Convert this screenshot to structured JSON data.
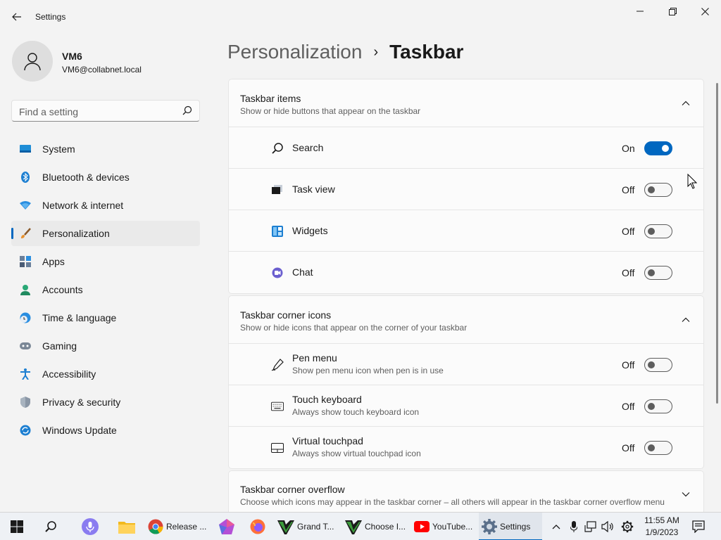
{
  "window": {
    "title": "Settings"
  },
  "profile": {
    "name": "VM6",
    "email": "VM6@collabnet.local"
  },
  "search": {
    "placeholder": "Find a setting"
  },
  "nav": {
    "items": [
      {
        "label": "System",
        "icon": "system-icon"
      },
      {
        "label": "Bluetooth & devices",
        "icon": "bluetooth-icon"
      },
      {
        "label": "Network & internet",
        "icon": "network-icon"
      },
      {
        "label": "Personalization",
        "icon": "brush-icon",
        "selected": true
      },
      {
        "label": "Apps",
        "icon": "apps-icon"
      },
      {
        "label": "Accounts",
        "icon": "accounts-icon"
      },
      {
        "label": "Time & language",
        "icon": "clock-globe-icon"
      },
      {
        "label": "Gaming",
        "icon": "controller-icon"
      },
      {
        "label": "Accessibility",
        "icon": "accessibility-icon"
      },
      {
        "label": "Privacy & security",
        "icon": "shield-icon"
      },
      {
        "label": "Windows Update",
        "icon": "update-icon"
      }
    ]
  },
  "header": {
    "parent": "Personalization",
    "separator": "›",
    "current": "Taskbar"
  },
  "sections": {
    "taskbar_items": {
      "title": "Taskbar items",
      "description": "Show or hide buttons that appear on the taskbar",
      "rows": [
        {
          "label": "Search",
          "state": "On",
          "on": true,
          "icon": "search-icon"
        },
        {
          "label": "Task view",
          "state": "Off",
          "on": false,
          "icon": "task-view-icon"
        },
        {
          "label": "Widgets",
          "state": "Off",
          "on": false,
          "icon": "widgets-icon"
        },
        {
          "label": "Chat",
          "state": "Off",
          "on": false,
          "icon": "chat-icon"
        }
      ]
    },
    "corner_icons": {
      "title": "Taskbar corner icons",
      "description": "Show or hide icons that appear on the corner of your taskbar",
      "rows": [
        {
          "label": "Pen menu",
          "sub": "Show pen menu icon when pen is in use",
          "state": "Off",
          "on": false,
          "icon": "pen-icon"
        },
        {
          "label": "Touch keyboard",
          "sub": "Always show touch keyboard icon",
          "state": "Off",
          "on": false,
          "icon": "keyboard-icon"
        },
        {
          "label": "Virtual touchpad",
          "sub": "Always show virtual touchpad icon",
          "state": "Off",
          "on": false,
          "icon": "touchpad-icon"
        }
      ]
    },
    "corner_overflow": {
      "title": "Taskbar corner overflow",
      "description": "Choose which icons may appear in the taskbar corner – all others will appear in the taskbar corner overflow menu"
    }
  },
  "taskbar": {
    "apps": [
      {
        "label": "Release ...",
        "icon": "chrome-icon"
      },
      {
        "label": "Grand T...",
        "icon": "vim-icon"
      },
      {
        "label": "Choose I...",
        "icon": "vim-icon"
      },
      {
        "label": "YouTube...",
        "icon": "youtube-icon"
      },
      {
        "label": "Settings",
        "icon": "gear-icon",
        "active": true
      }
    ],
    "time": "11:55 AM",
    "date": "1/9/2023"
  },
  "colors": {
    "accent": "#0067c0",
    "background": "#f3f3f3",
    "card": "#fbfbfb"
  }
}
